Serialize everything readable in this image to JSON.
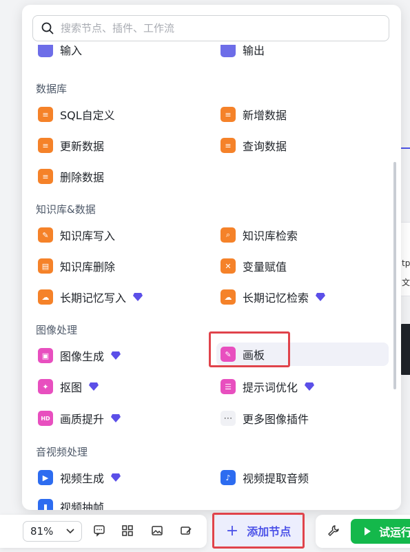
{
  "search": {
    "placeholder": "搜索节点、插件、工作流"
  },
  "partial_top": {
    "left_label": "输入",
    "right_label": "输出"
  },
  "sections": [
    {
      "title": "数据库",
      "items": [
        {
          "label": "SQL自定义",
          "icon": "database-icon",
          "color": "#f58229"
        },
        {
          "label": "新增数据",
          "icon": "database-add-icon",
          "color": "#f58229"
        },
        {
          "label": "更新数据",
          "icon": "database-update-icon",
          "color": "#f58229"
        },
        {
          "label": "查询数据",
          "icon": "database-search-icon",
          "color": "#f58229"
        },
        {
          "label": "删除数据",
          "icon": "database-delete-icon",
          "color": "#f58229"
        }
      ]
    },
    {
      "title": "知识库&数据",
      "items": [
        {
          "label": "知识库写入",
          "icon": "knowledge-write-icon",
          "color": "#f58229"
        },
        {
          "label": "知识库检索",
          "icon": "knowledge-search-icon",
          "color": "#f58229"
        },
        {
          "label": "知识库删除",
          "icon": "knowledge-delete-icon",
          "color": "#f58229"
        },
        {
          "label": "变量赋值",
          "icon": "variable-assign-icon",
          "color": "#f58229"
        },
        {
          "label": "长期记忆写入",
          "icon": "memory-write-icon",
          "color": "#f58229",
          "premium": true
        },
        {
          "label": "长期记忆检索",
          "icon": "memory-search-icon",
          "color": "#f58229",
          "premium": true
        }
      ]
    },
    {
      "title": "图像处理",
      "items": [
        {
          "label": "图像生成",
          "icon": "image-generate-icon",
          "color": "#e84fbf",
          "premium": true
        },
        {
          "label": "画板",
          "icon": "canvas-board-icon",
          "color": "#e84fbf",
          "active": true
        },
        {
          "label": "抠图",
          "icon": "cutout-icon",
          "color": "#e84fbf",
          "premium": true
        },
        {
          "label": "提示词优化",
          "icon": "prompt-optimize-icon",
          "color": "#e84fbf",
          "premium": true
        },
        {
          "label": "画质提升",
          "icon": "hd-icon",
          "color": "#e84fbf",
          "premium": true
        },
        {
          "label": "更多图像插件",
          "icon": "more-icon",
          "color": "#f0f1f5"
        }
      ]
    },
    {
      "title": "音视频处理",
      "items": [
        {
          "label": "视频生成",
          "icon": "video-generate-icon",
          "color": "#2d6cf0",
          "premium": true
        },
        {
          "label": "视频提取音频",
          "icon": "video-audio-icon",
          "color": "#2d6cf0"
        },
        {
          "label": "视频抽帧",
          "icon": "video-frame-icon",
          "color": "#2d6cf0"
        }
      ]
    }
  ],
  "toolbar": {
    "zoom": "81%",
    "add_node_label": "添加节点",
    "run_label": "试运行"
  },
  "background": {
    "text_1": "tp",
    "text_2": "文"
  },
  "colors": {
    "accent": "#4d53e8",
    "run": "#14b84b",
    "highlight_box": "#e0434b",
    "premium_gem": "#5b4fe8"
  }
}
